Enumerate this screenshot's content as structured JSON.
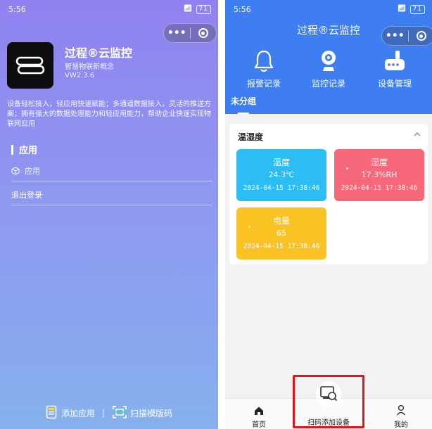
{
  "left_screen": {
    "status": {
      "time": "5:56",
      "signal": "⊙ ⚠ ⦿   ▲ᵇᵃˡˡ ▲ᵇᵃˡˡ",
      "battery": "71"
    },
    "app": {
      "title": "过程®云监控",
      "subtitle": "智慧物联新概念",
      "version": "VW2.3.6",
      "description": "设备轻松接入，轻应用快速赋能；多通道数据接入，灵活的推送方案；拥有强大的数据处理能力和轻应用能力，帮助企业快速实现物联网应用"
    },
    "section_title": "应用",
    "menu": {
      "apps": "应用",
      "logout": "退出登录"
    },
    "bottom": {
      "add_app": "添加应用",
      "divider": "|",
      "scan_template": "扫描模版码"
    },
    "capsule": {
      "more": "•••"
    }
  },
  "right_screen": {
    "status": {
      "time": "5:56",
      "battery": "71"
    },
    "title": "过程®云监控",
    "quick_actions": [
      {
        "label": "报警记录",
        "icon": "bell-icon"
      },
      {
        "label": "监控记录",
        "icon": "webcam-icon"
      },
      {
        "label": "设备管理",
        "icon": "device-icon"
      }
    ],
    "group_tab": "未分组",
    "card": {
      "title": "温湿度",
      "tiles": [
        {
          "name": "温度",
          "value": "24.3℃",
          "timestamp": "2024-04-15 17:38:46",
          "color": "#2bbdf4"
        },
        {
          "name": "湿度",
          "value": "17.3%RH",
          "timestamp": "2024-04-15 17:38:46",
          "color": "#f7687a"
        },
        {
          "name": "电量",
          "value": "65",
          "timestamp": "2024-04-15 17:38:46",
          "color": "#fbc224"
        }
      ]
    },
    "tabbar": {
      "home": "首页",
      "scan_add": "扫码添加设备",
      "mine": "我的"
    },
    "colors": {
      "header": "#3e7ef0",
      "highlight_box": "#e3151a"
    }
  }
}
